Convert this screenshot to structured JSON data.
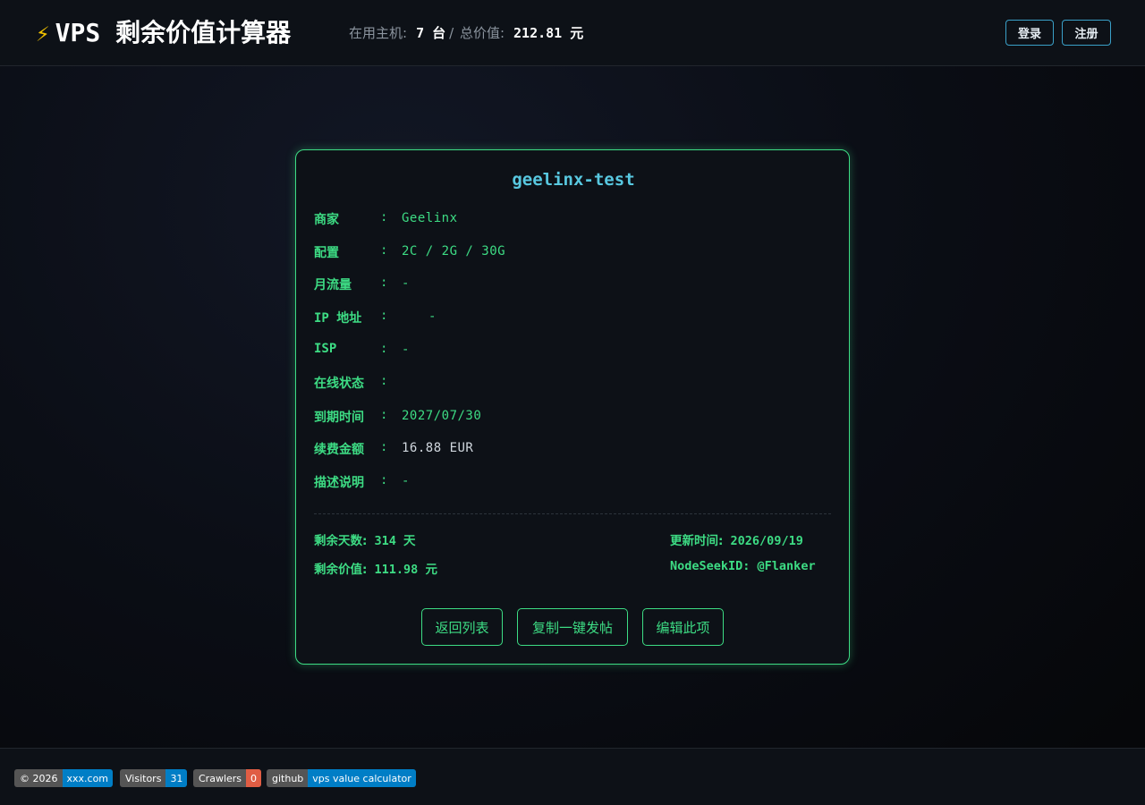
{
  "header": {
    "logo_icon": "⚡",
    "title": "VPS 剩余价值计算器",
    "hosts_label": "在用主机:",
    "hosts_value": "7 台",
    "sep": "/",
    "total_label": "总价值:",
    "total_value": "212.81 元",
    "login_label": "登录",
    "register_label": "注册"
  },
  "card": {
    "title": "geelinx-test",
    "fields": [
      {
        "label": "商家",
        "value": "Geelinx"
      },
      {
        "label": "配置",
        "value": "2C / 2G / 30G"
      },
      {
        "label": "月流量",
        "value": "-"
      },
      {
        "label": "IP 地址",
        "value": "-"
      },
      {
        "label": "ISP",
        "value": "-"
      },
      {
        "label": "在线状态",
        "value": ""
      },
      {
        "label": "到期时间",
        "value": "2027/07/30"
      },
      {
        "label": "续费金额",
        "value": "16.88 EUR"
      },
      {
        "label": "描述说明",
        "value": "-"
      }
    ],
    "colon": ":",
    "remaining_days_label": "剩余天数:",
    "remaining_days_value": "314 天",
    "remaining_value_label": "剩余价值:",
    "remaining_value_value": "111.98 元",
    "updated_label": "更新时间:",
    "updated_value": "2026/09/19",
    "nodeseek_label": "NodeSeekID:",
    "nodeseek_value": "@Flanker",
    "buttons": {
      "back": "返回列表",
      "copy": "复制一键发帖",
      "edit": "编辑此项"
    }
  },
  "footer": {
    "badges": [
      {
        "left": "© 2026",
        "right": "xxx.com",
        "color": "#007ec6"
      },
      {
        "left": "Visitors",
        "right": "31",
        "color": "#007ec6"
      },
      {
        "left": "Crawlers",
        "right": "0",
        "color": "#e05d44"
      },
      {
        "left": "github",
        "right": "vps value calculator",
        "color": "#007ec6"
      }
    ]
  },
  "colors": {
    "accent_green": "#3ddc84",
    "title_cyan": "#58c8e0",
    "header_button_border": "#3aa0c8"
  }
}
